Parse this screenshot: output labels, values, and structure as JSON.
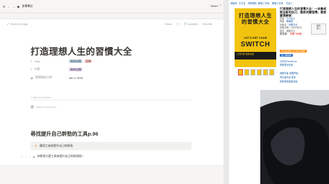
{
  "notion": {
    "breadcrumb": [
      "習慣筆記"
    ],
    "share": "Share",
    "modal": {
      "open_as_page": "Open as page",
      "share": "Share",
      "updates": "Updates",
      "favorite": "Favorite",
      "title": "打造理想人生的習慣大全",
      "properties": [
        {
          "name": "Tags",
          "icon": "list-icon",
          "tags": [
            {
              "text": "刷刷成團",
              "color": "blue"
            },
            {
              "text": "習慣",
              "color": "red"
            }
          ]
        },
        {
          "name": "分類",
          "icon": "list-icon",
          "tags": [
            {
              "text": "刷刷成團",
              "color": "purple"
            }
          ]
        },
        {
          "name": "閱讀開始日期",
          "icon": "calendar-icon",
          "value": "Jan 4, 2021"
        }
      ],
      "add_property": "+ Add a property",
      "add_comment": "Add a comment...",
      "heading": "尋找提升自己幹勁的工具p.96",
      "callout": "藉用工具來提升自己的幹勁",
      "toggle": "你想用什麼工具來提升自己的幹勁呢?"
    }
  },
  "store": {
    "breadcrumb": [
      "博客來",
      "中文書",
      "商業理財",
      "職場工作術",
      "職場工作術",
      "代言人"
    ],
    "book": {
      "title": "打造理想人生的習慣大全：一本書成就全新的自己，徹底改變習慣，徹底實現夢想",
      "cover_title": "打造理想人生的習慣大全",
      "cover_en_small": "LET'S GET YOUR",
      "cover_en_big": "SWITCH",
      "cover_strip": "立刻行動 啟動改變",
      "rows": [
        {
          "label": "作者：",
          "value": "古川武士"
        },
        {
          "label": "譯者：",
          "value": "陳美瑛"
        },
        {
          "label": "出版社：",
          "value": "采實文化"
        },
        {
          "label": "出版日期：",
          "value": "2020/06/24"
        },
        {
          "label": "語言：",
          "value": "繁體中文"
        }
      ],
      "price_label": "優惠價：",
      "discount": "79折",
      "price": "316元",
      "side_box_line1": "請先",
      "side_box_line2": "登入",
      "extra_lines": [
        "本商品適用 電子書 加價購",
        "加入購物車",
        "分享到 Facebook",
        "看看誰也在讀",
        "追蹤作者 追蹤譯者",
        "同作者作品 更多",
        "看看其他讀者評論"
      ]
    }
  },
  "colors": {
    "notion_bg": "#f6f5f3",
    "cover_yellow": "#f2c30f",
    "store_link": "#1a5fa8",
    "discount_red": "#e4393c"
  }
}
